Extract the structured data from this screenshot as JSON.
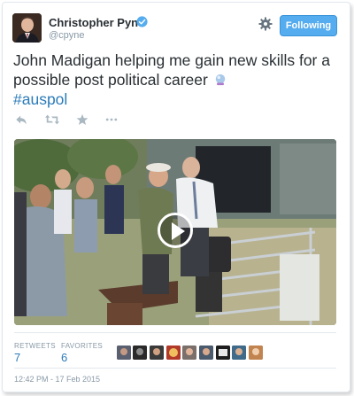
{
  "user": {
    "name": "Christopher Pyne",
    "handle": "@cpyne",
    "follow_label": "Following"
  },
  "tweet": {
    "text": "John Madigan helping me gain new skills for a possible post political career",
    "hashtag": "#auspol"
  },
  "icons": {
    "verified": "verified-badge-icon",
    "crystal_ball": "crystal-ball-emoji-icon",
    "settings": "gear-icon",
    "reply": "reply-icon",
    "retweet": "retweet-icon",
    "favorite": "star-icon",
    "more": "more-icon",
    "play": "play-icon"
  },
  "stats": {
    "retweets_label": "RETWEETS",
    "retweets": "7",
    "favorites_label": "FAVORITES",
    "favorites": "6"
  },
  "timestamp": "12:42 PM - 17 Feb 2015",
  "colors": {
    "accent": "#55acee",
    "link": "#2b7bb9",
    "muted": "#8899a6",
    "text": "#292f33"
  }
}
